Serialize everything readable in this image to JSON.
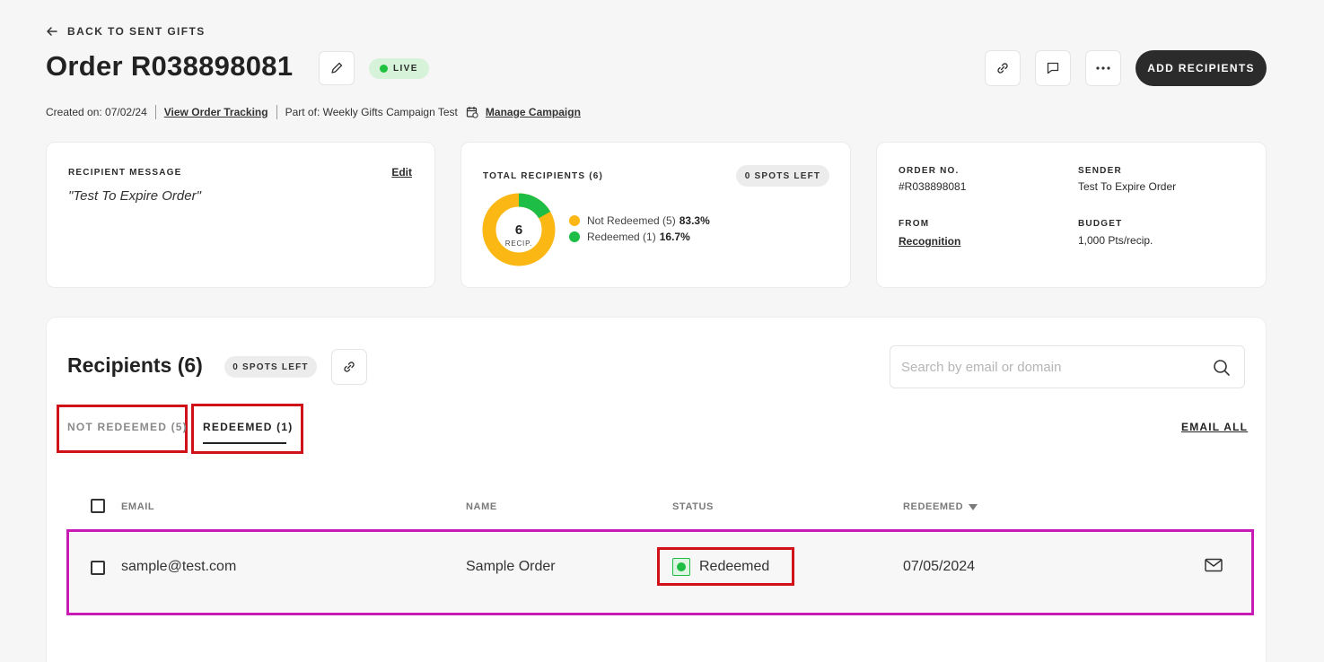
{
  "header": {
    "back_label": "BACK TO SENT GIFTS",
    "title": "Order R038898081",
    "status_badge": "LIVE",
    "add_recipients_label": "ADD RECIPIENTS"
  },
  "meta": {
    "created_on": "Created on: 07/02/24",
    "view_tracking": "View Order Tracking",
    "part_of": "Part of: Weekly Gifts Campaign Test",
    "manage_campaign": "Manage Campaign"
  },
  "message_card": {
    "label": "RECIPIENT MESSAGE",
    "edit": "Edit",
    "message": "\"Test To Expire Order\""
  },
  "recipients_card": {
    "label": "TOTAL RECIPIENTS (6)",
    "spots_left": "0 SPOTS LEFT",
    "donut_count": "6",
    "donut_unit": "RECIP.",
    "legend": [
      {
        "label": "Not Redeemed (5)",
        "pct": "83.3%",
        "value": 5,
        "color": "#fbb714"
      },
      {
        "label": "Redeemed (1)",
        "pct": "16.7%",
        "value": 1,
        "color": "#1ebd45"
      }
    ]
  },
  "order_card": {
    "order_no_label": "ORDER NO.",
    "order_no": "#R038898081",
    "sender_label": "SENDER",
    "sender": "Test To Expire Order",
    "from_label": "FROM",
    "from": "Recognition",
    "budget_label": "BUDGET",
    "budget": "1,000 Pts/recip."
  },
  "recipients": {
    "title": "Recipients (6)",
    "spots_left": "0 SPOTS LEFT",
    "search_placeholder": "Search by email or domain",
    "tabs": [
      {
        "label": "NOT REDEEMED (5)",
        "active": false
      },
      {
        "label": "REDEEMED (1)",
        "active": true
      }
    ],
    "email_all": "EMAIL ALL",
    "columns": [
      "EMAIL",
      "NAME",
      "STATUS",
      "REDEEMED"
    ],
    "rows": [
      {
        "email": "sample@test.com",
        "name": "Sample Order",
        "status": "Redeemed",
        "redeemed": "07/05/2024"
      }
    ]
  },
  "colors": {
    "accent_dark": "#2b2b2b",
    "live_green": "#1fc13f",
    "not_redeemed": "#fbb714",
    "redeemed": "#1ebd45",
    "highlight_red": "#d0111a",
    "highlight_magenta": "#c81ab4"
  }
}
